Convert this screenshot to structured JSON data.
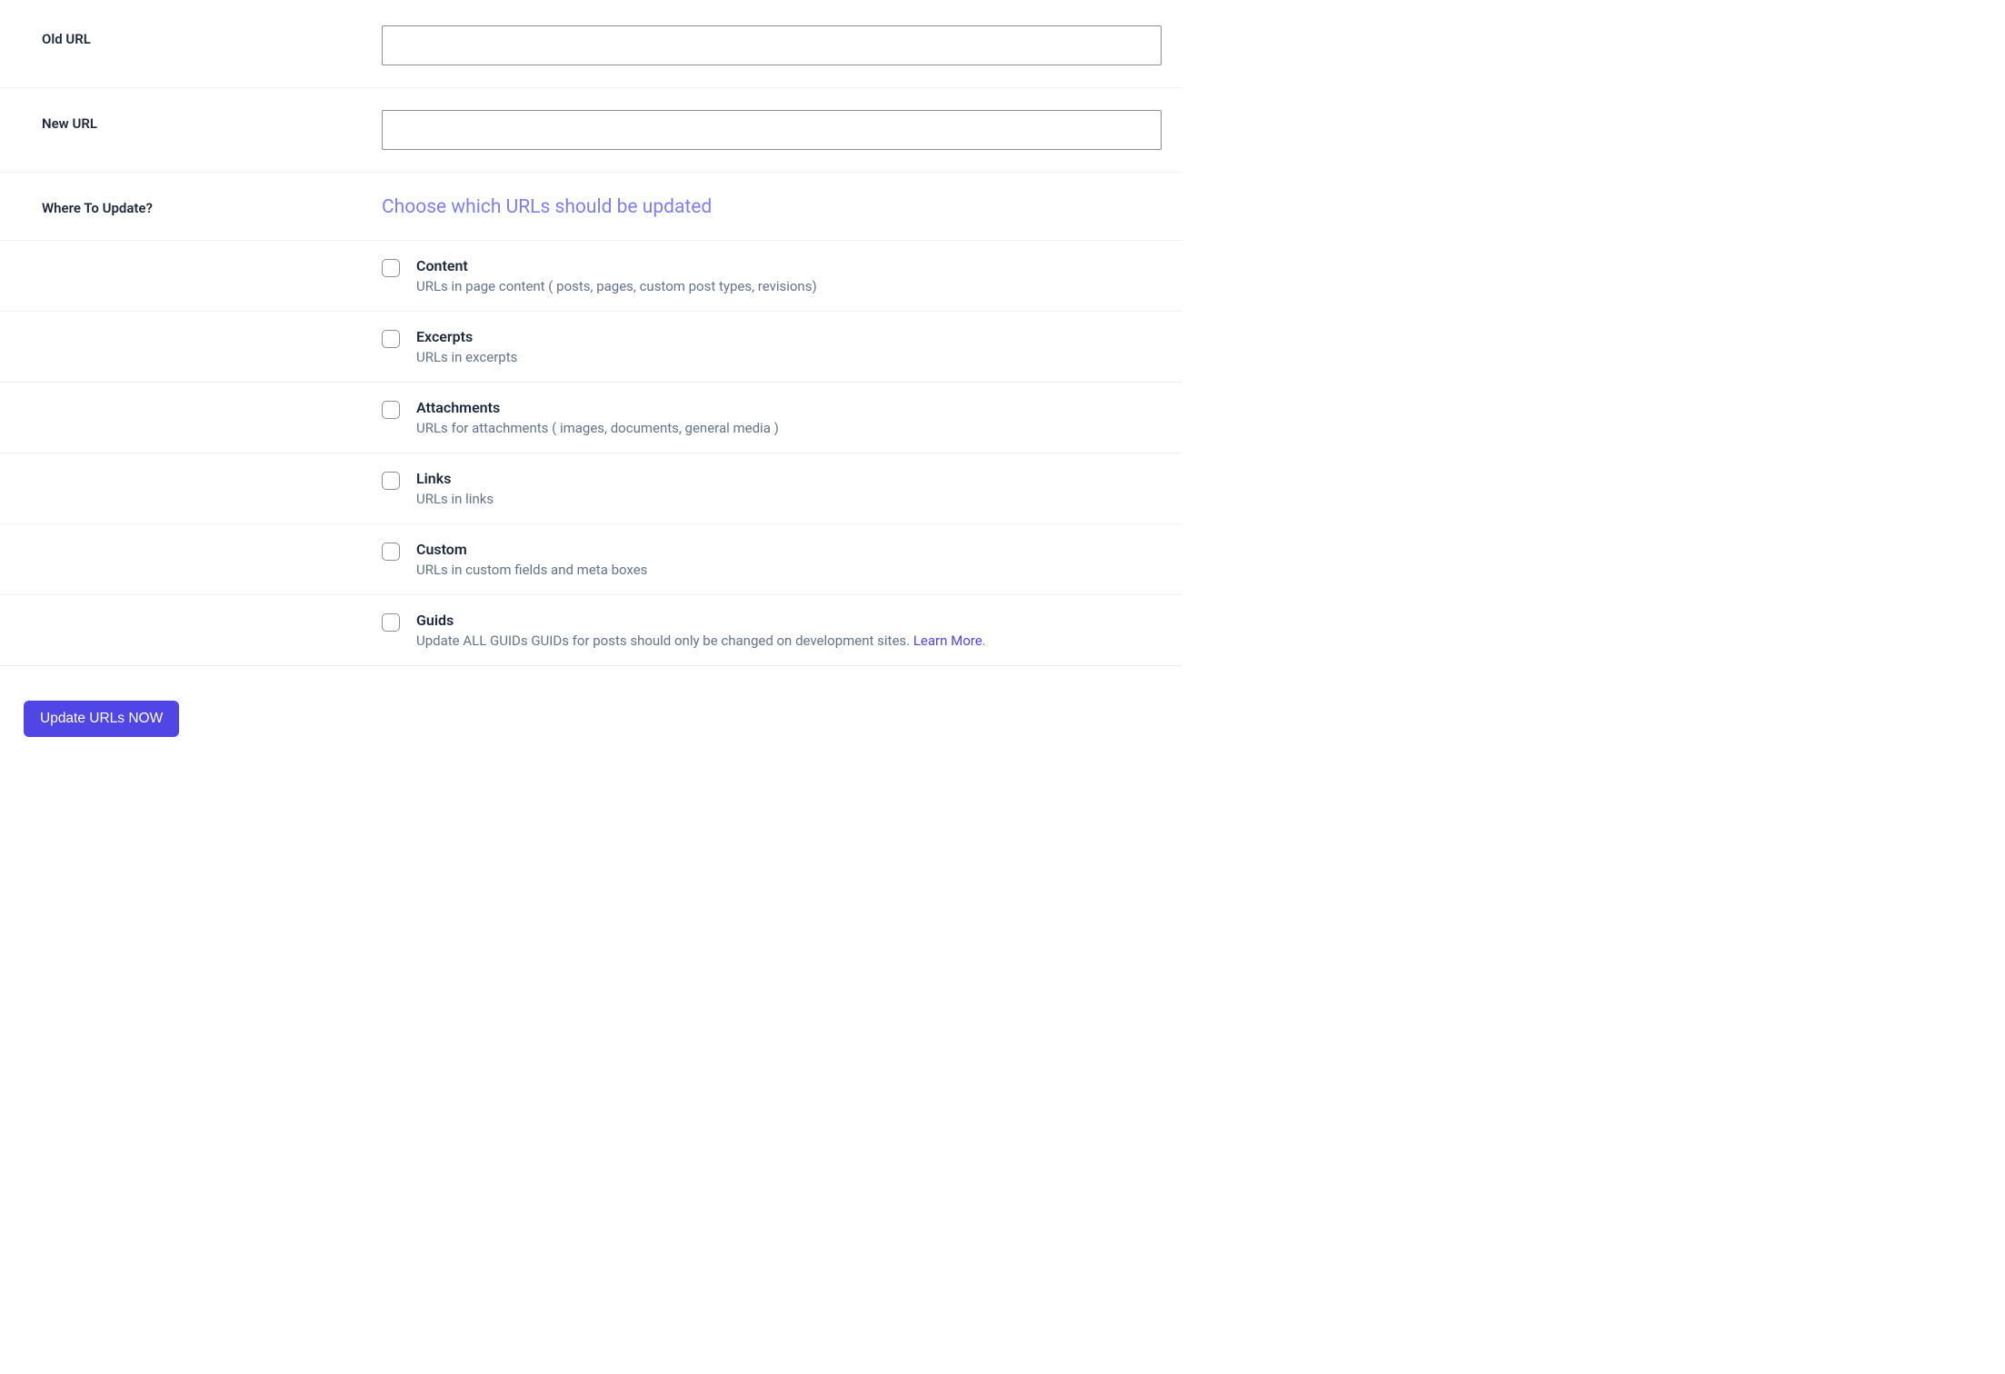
{
  "fields": {
    "old_url": {
      "label": "Old URL",
      "value": ""
    },
    "new_url": {
      "label": "New URL",
      "value": ""
    },
    "where_label": "Where To Update?",
    "where_heading": "Choose which URLs should be updated"
  },
  "options": {
    "content": {
      "title": "Content",
      "desc": "URLs in page content ( posts, pages, custom post types, revisions)"
    },
    "excerpts": {
      "title": "Excerpts",
      "desc": "URLs in excerpts"
    },
    "attachments": {
      "title": "Attachments",
      "desc": "URLs for attachments ( images, documents, general media )"
    },
    "links": {
      "title": "Links",
      "desc": "URLs in links"
    },
    "custom": {
      "title": "Custom",
      "desc": "URLs in custom fields and meta boxes"
    },
    "guids": {
      "title": "Guids",
      "desc_prefix": "Update ALL GUIDs GUIDs for posts should only be changed on development sites. ",
      "link_text": "Learn More",
      "desc_suffix": "."
    }
  },
  "submit_label": "Update URLs NOW"
}
